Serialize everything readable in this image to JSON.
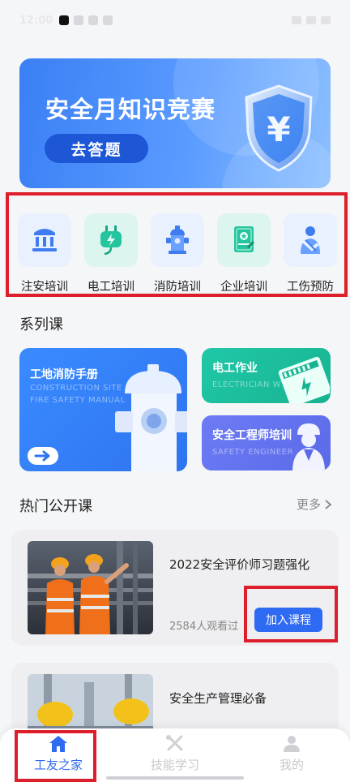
{
  "status_bar": {
    "time": "12:00"
  },
  "banner": {
    "title": "安全月知识竞赛",
    "button_label": "去答题",
    "shield_glyph": "¥"
  },
  "categories": [
    {
      "label": "注安培训",
      "icon": "building-icon",
      "bg": "#e9f1ff"
    },
    {
      "label": "电工培训",
      "icon": "power-plug-icon",
      "bg": "#dcf6ef"
    },
    {
      "label": "消防培训",
      "icon": "fire-hydrant-icon",
      "bg": "#e9f1ff"
    },
    {
      "label": "企业培训",
      "icon": "certificate-icon",
      "bg": "#dcf6ef"
    },
    {
      "label": "工伤预防",
      "icon": "injured-person-icon",
      "bg": "#e9f1ff"
    }
  ],
  "series": {
    "title": "系列课",
    "cards": [
      {
        "title": "工地消防手册",
        "subtitle": "CONSTRUCTION SITE FIRE SAFETY MANUAL"
      },
      {
        "title": "电工作业",
        "subtitle": "ELECTRICIAN W"
      },
      {
        "title": "安全工程师培训",
        "subtitle": "SAFETY ENGINEER"
      }
    ]
  },
  "hot": {
    "title": "热门公开课",
    "more_label": "更多",
    "courses": [
      {
        "title": "2022安全评价师习题强化",
        "views": "2584人观看过",
        "button_label": "加入课程"
      },
      {
        "title": "安全生产管理必备"
      }
    ]
  },
  "tabbar": [
    {
      "label": "工友之家",
      "icon": "home-icon",
      "active": true
    },
    {
      "label": "技能学习",
      "icon": "tools-icon",
      "active": false
    },
    {
      "label": "我的",
      "icon": "user-icon",
      "active": false
    }
  ],
  "colors": {
    "accent": "#2f6bf2",
    "highlight_frame": "#dc1f2a"
  }
}
